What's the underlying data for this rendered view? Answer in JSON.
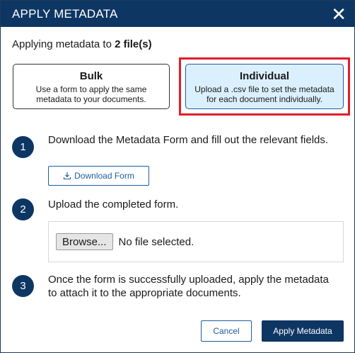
{
  "dialog": {
    "title": "APPLY METADATA",
    "close_icon": "close-icon"
  },
  "subtitle": {
    "prefix": "Applying metadata to ",
    "count": "2 file(s)"
  },
  "modes": {
    "bulk": {
      "title": "Bulk",
      "description": "Use a form to apply the same metadata to your documents."
    },
    "individual": {
      "title": "Individual",
      "description": "Upload a .csv file to set the metadata for each document individually.",
      "selected": true
    }
  },
  "steps": [
    {
      "number": "1",
      "text": "Download the Metadata Form and fill out the relevant fields."
    },
    {
      "number": "2",
      "text": "Upload the completed form."
    },
    {
      "number": "3",
      "text": "Once the form is successfully uploaded, apply the metadata to attach it to the appropriate documents."
    }
  ],
  "download_button": {
    "label": "Download Form",
    "icon": "download-icon"
  },
  "upload": {
    "browse_label": "Browse...",
    "status": "No file selected."
  },
  "footer": {
    "cancel_label": "Cancel",
    "apply_label": "Apply Metadata"
  },
  "colors": {
    "header": "#0e3663",
    "accent": "#1b5e9e",
    "selected_bg": "#dbf0ff",
    "highlight": "#e21d2a"
  }
}
